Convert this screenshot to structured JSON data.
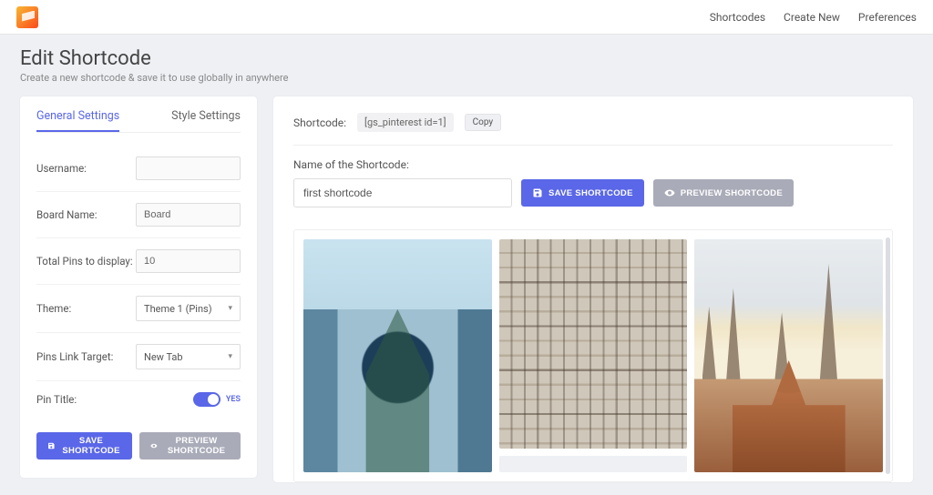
{
  "nav": {
    "items": [
      "Shortcodes",
      "Create New",
      "Preferences"
    ]
  },
  "page": {
    "title": "Edit Shortcode",
    "subtitle": "Create a new shortcode & save it to use globally in anywhere"
  },
  "sidebar": {
    "tabs": {
      "general": "General Settings",
      "style": "Style Settings"
    },
    "username_label": "Username:",
    "username_value": "",
    "board_label": "Board Name:",
    "board_value": "Board",
    "total_label": "Total Pins to display:",
    "total_value": "10",
    "theme_label": "Theme:",
    "theme_value": "Theme 1 (Pins)",
    "target_label": "Pins Link Target:",
    "target_value": "New Tab",
    "pintitle_label": "Pin Title:",
    "pintitle_state": "YES",
    "save_btn": "Save Shortcode",
    "preview_btn": "Preview Shortcode"
  },
  "main": {
    "sc_label": "Shortcode:",
    "sc_value": "[gs_pinterest id=1]",
    "copy": "Copy",
    "name_label": "Name of the Shortcode:",
    "name_value": "first shortcode",
    "save_btn": "Save Shortcode",
    "preview_btn": "Preview Shortcode"
  }
}
